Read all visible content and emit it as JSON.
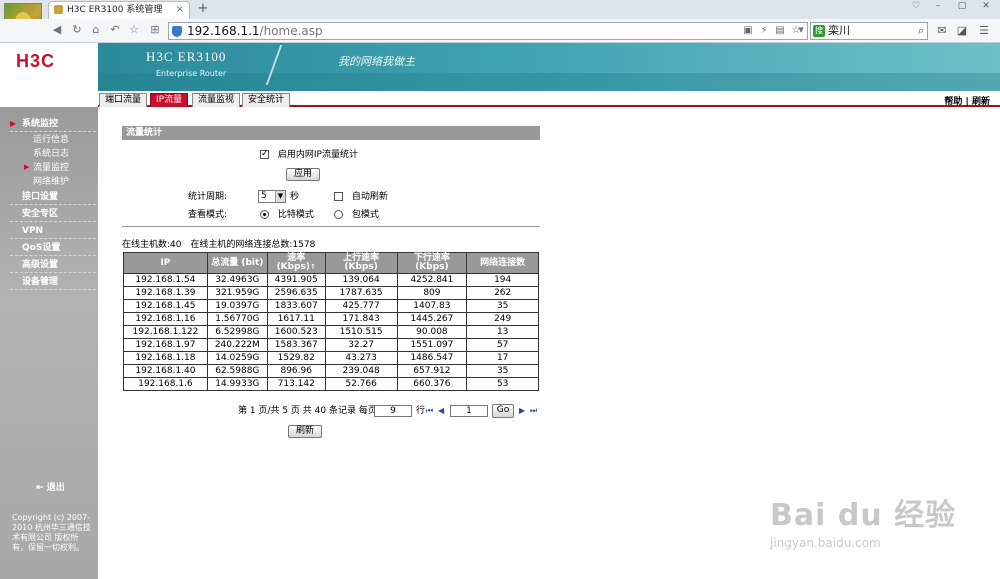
{
  "browser": {
    "tab_title": "H3C ER3100 系统管理",
    "tab_close": "×",
    "new_tab": "+",
    "url_host": "192.168.1.1",
    "url_path": "/home.asp",
    "search_value": "栾川",
    "search_logo": "搜"
  },
  "header": {
    "logo": "H3C",
    "product": "H3C ER3100",
    "product_sub": "Enterprise Router",
    "slogan": "我的网络我做主"
  },
  "nav": {
    "tabs": [
      "端口流量",
      "IP流量",
      "流量监视",
      "安全统计"
    ],
    "active": 1,
    "help": "帮助",
    "separator": "|",
    "refresh": "刷新"
  },
  "sidebar": {
    "system_monitor": "系统监控",
    "subs": [
      "运行信息",
      "系统日志",
      "流量监控",
      "网络维护"
    ],
    "active_sub": 2,
    "items": [
      "接口设置",
      "安全专区",
      "VPN",
      "QoS设置",
      "高级设置",
      "设备管理"
    ],
    "logout": "退出",
    "copyright": "Copyright (c) 2007-2010 杭州华三通信技术有限公司 版权所有，保留一切权利。"
  },
  "content": {
    "section_title": "流量统计",
    "enable_label": "启用内网IP流量统计",
    "apply_btn": "应用",
    "period_label": "统计周期:",
    "period_value": "5",
    "period_unit": "秒",
    "auto_refresh": "自动刷新",
    "view_label": "查看模式:",
    "mode_bit": "比特模式",
    "mode_packet": "包模式",
    "online_hosts_label": "在线主机数:",
    "online_hosts": "40",
    "online_conns_label": "在线主机的网络连接总数:",
    "online_conns": "1578"
  },
  "table": {
    "headers": [
      "IP",
      "总流量 (bit)",
      "速率\n(Kbps)",
      "上行速率\n(Kbps)",
      "下行速率\n(Kbps)",
      "网络连接数"
    ],
    "sort_arrow": "↑",
    "rows": [
      [
        "192.168.1.54",
        "32.4963G",
        "4391.905",
        "139.064",
        "4252.841",
        "194"
      ],
      [
        "192.168.1.39",
        "321.959G",
        "2596.635",
        "1787.635",
        "809",
        "262"
      ],
      [
        "192.168.1.45",
        "19.0397G",
        "1833.607",
        "425.777",
        "1407.83",
        "35"
      ],
      [
        "192.168.1.16",
        "1.56770G",
        "1617.11",
        "171.843",
        "1445.267",
        "249"
      ],
      [
        "192.168.1.122",
        "6.52998G",
        "1600.523",
        "1510.515",
        "90.008",
        "13"
      ],
      [
        "192.168.1.97",
        "240.222M",
        "1583.367",
        "32.27",
        "1551.097",
        "57"
      ],
      [
        "192.168.1.18",
        "14.0259G",
        "1529.82",
        "43.273",
        "1486.547",
        "17"
      ],
      [
        "192.168.1.40",
        "62.5988G",
        "896.96",
        "239.048",
        "657.912",
        "35"
      ],
      [
        "192.168.1.6",
        "14.9933G",
        "713.142",
        "52.766",
        "660.376",
        "53"
      ]
    ]
  },
  "pager": {
    "text": "第 1 页/共 5 页 共 40 条记录 每页",
    "per_page": "9",
    "row_unit": "行",
    "page_input": "1",
    "go_btn": "Go",
    "refresh_btn": "刷新"
  },
  "watermark": {
    "top": "Bai du 经验",
    "bottom": "jingyan.baidu.com"
  }
}
